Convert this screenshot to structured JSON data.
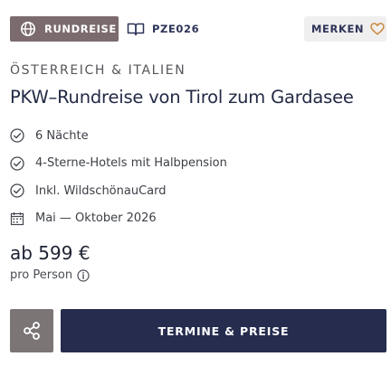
{
  "badges": {
    "type_label": "RUNDREISE",
    "code": "PZE026"
  },
  "merken": {
    "label": "MERKEN"
  },
  "region": "ÖSTERREICH & ITALIEN",
  "title": "PKW–Rundreise von Tirol zum Gardasee",
  "features": [
    {
      "icon": "check-circle-icon",
      "label": "6 Nächte"
    },
    {
      "icon": "check-circle-icon",
      "label": "4-Sterne-Hotels mit Halbpension"
    },
    {
      "icon": "check-circle-icon",
      "label": "Inkl. WildschönauCard"
    },
    {
      "icon": "calendar-icon",
      "label": "Mai — Oktober 2026"
    }
  ],
  "price": {
    "amount": "ab 599 €",
    "unit": "pro Person"
  },
  "cta": {
    "label": "TERMINE & PREISE"
  },
  "colors": {
    "badge_bg": "#7b6b6e",
    "merken_bg": "#f0efef",
    "heart": "#c9893f",
    "cta_bg": "#262c4e",
    "share_bg": "#7b7576"
  }
}
